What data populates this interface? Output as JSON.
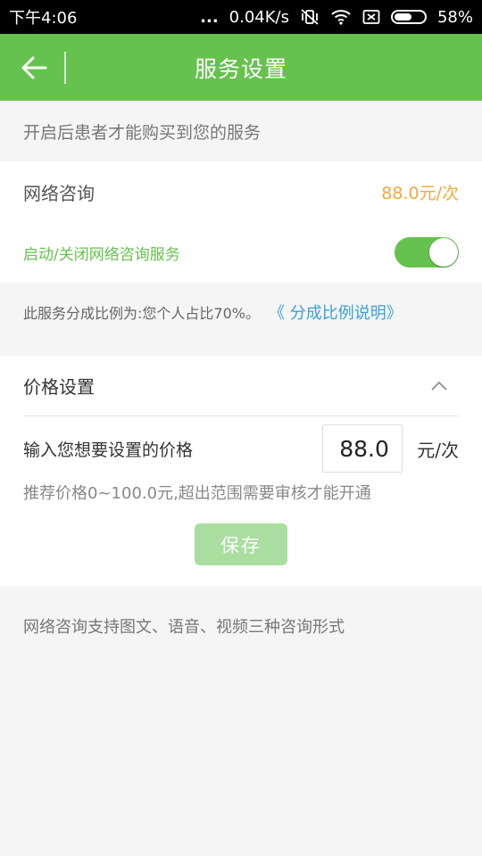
{
  "status_bar": {
    "time": "下午4:06",
    "dots": "...",
    "net_speed": "0.04K/s",
    "battery": "58%",
    "battery_level": 0.58
  },
  "header": {
    "title": "服务设置"
  },
  "notice": "开启后患者才能购买到您的服务",
  "service": {
    "name": "网络咨询",
    "price": "88.0元/次",
    "toggle_label": "启动/关闭网络咨询服务",
    "enabled": true
  },
  "share": {
    "text": "此服务分成比例为:您个人占比70%。",
    "link": "《 分成比例说明》"
  },
  "price_settings": {
    "title": "价格设置",
    "input_label": "输入您想要设置的价格",
    "input_value": "88.0",
    "unit": "元/次",
    "hint": "推荐价格0~100.0元,超出范围需要审核才能开通",
    "save_label": "保存"
  },
  "footer_note": "网络咨询支持图文、语音、视频三种咨询形式",
  "colors": {
    "primary_green": "#66c24e",
    "price_orange": "#f2a93b",
    "link_blue": "#3aa0d8"
  }
}
